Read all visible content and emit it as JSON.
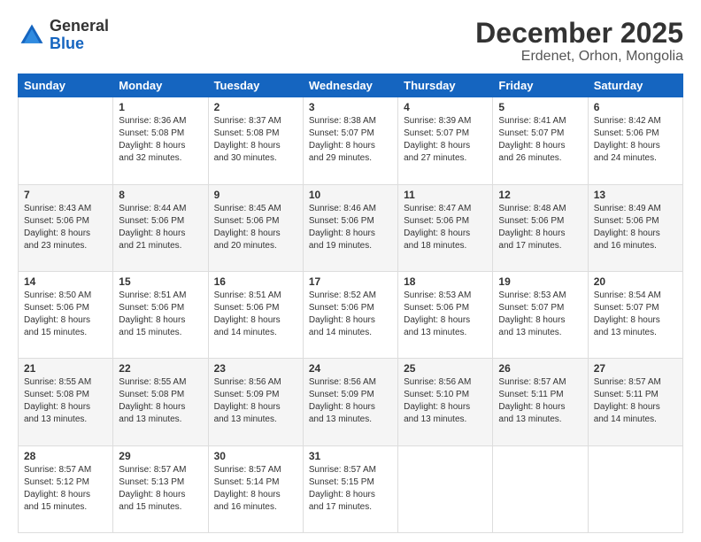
{
  "header": {
    "logo_line1": "General",
    "logo_line2": "Blue",
    "month": "December 2025",
    "location": "Erdenet, Orhon, Mongolia"
  },
  "weekdays": [
    "Sunday",
    "Monday",
    "Tuesday",
    "Wednesday",
    "Thursday",
    "Friday",
    "Saturday"
  ],
  "weeks": [
    [
      {
        "day": "",
        "info": ""
      },
      {
        "day": "1",
        "info": "Sunrise: 8:36 AM\nSunset: 5:08 PM\nDaylight: 8 hours\nand 32 minutes."
      },
      {
        "day": "2",
        "info": "Sunrise: 8:37 AM\nSunset: 5:08 PM\nDaylight: 8 hours\nand 30 minutes."
      },
      {
        "day": "3",
        "info": "Sunrise: 8:38 AM\nSunset: 5:07 PM\nDaylight: 8 hours\nand 29 minutes."
      },
      {
        "day": "4",
        "info": "Sunrise: 8:39 AM\nSunset: 5:07 PM\nDaylight: 8 hours\nand 27 minutes."
      },
      {
        "day": "5",
        "info": "Sunrise: 8:41 AM\nSunset: 5:07 PM\nDaylight: 8 hours\nand 26 minutes."
      },
      {
        "day": "6",
        "info": "Sunrise: 8:42 AM\nSunset: 5:06 PM\nDaylight: 8 hours\nand 24 minutes."
      }
    ],
    [
      {
        "day": "7",
        "info": "Sunrise: 8:43 AM\nSunset: 5:06 PM\nDaylight: 8 hours\nand 23 minutes."
      },
      {
        "day": "8",
        "info": "Sunrise: 8:44 AM\nSunset: 5:06 PM\nDaylight: 8 hours\nand 21 minutes."
      },
      {
        "day": "9",
        "info": "Sunrise: 8:45 AM\nSunset: 5:06 PM\nDaylight: 8 hours\nand 20 minutes."
      },
      {
        "day": "10",
        "info": "Sunrise: 8:46 AM\nSunset: 5:06 PM\nDaylight: 8 hours\nand 19 minutes."
      },
      {
        "day": "11",
        "info": "Sunrise: 8:47 AM\nSunset: 5:06 PM\nDaylight: 8 hours\nand 18 minutes."
      },
      {
        "day": "12",
        "info": "Sunrise: 8:48 AM\nSunset: 5:06 PM\nDaylight: 8 hours\nand 17 minutes."
      },
      {
        "day": "13",
        "info": "Sunrise: 8:49 AM\nSunset: 5:06 PM\nDaylight: 8 hours\nand 16 minutes."
      }
    ],
    [
      {
        "day": "14",
        "info": "Sunrise: 8:50 AM\nSunset: 5:06 PM\nDaylight: 8 hours\nand 15 minutes."
      },
      {
        "day": "15",
        "info": "Sunrise: 8:51 AM\nSunset: 5:06 PM\nDaylight: 8 hours\nand 15 minutes."
      },
      {
        "day": "16",
        "info": "Sunrise: 8:51 AM\nSunset: 5:06 PM\nDaylight: 8 hours\nand 14 minutes."
      },
      {
        "day": "17",
        "info": "Sunrise: 8:52 AM\nSunset: 5:06 PM\nDaylight: 8 hours\nand 14 minutes."
      },
      {
        "day": "18",
        "info": "Sunrise: 8:53 AM\nSunset: 5:06 PM\nDaylight: 8 hours\nand 13 minutes."
      },
      {
        "day": "19",
        "info": "Sunrise: 8:53 AM\nSunset: 5:07 PM\nDaylight: 8 hours\nand 13 minutes."
      },
      {
        "day": "20",
        "info": "Sunrise: 8:54 AM\nSunset: 5:07 PM\nDaylight: 8 hours\nand 13 minutes."
      }
    ],
    [
      {
        "day": "21",
        "info": "Sunrise: 8:55 AM\nSunset: 5:08 PM\nDaylight: 8 hours\nand 13 minutes."
      },
      {
        "day": "22",
        "info": "Sunrise: 8:55 AM\nSunset: 5:08 PM\nDaylight: 8 hours\nand 13 minutes."
      },
      {
        "day": "23",
        "info": "Sunrise: 8:56 AM\nSunset: 5:09 PM\nDaylight: 8 hours\nand 13 minutes."
      },
      {
        "day": "24",
        "info": "Sunrise: 8:56 AM\nSunset: 5:09 PM\nDaylight: 8 hours\nand 13 minutes."
      },
      {
        "day": "25",
        "info": "Sunrise: 8:56 AM\nSunset: 5:10 PM\nDaylight: 8 hours\nand 13 minutes."
      },
      {
        "day": "26",
        "info": "Sunrise: 8:57 AM\nSunset: 5:11 PM\nDaylight: 8 hours\nand 13 minutes."
      },
      {
        "day": "27",
        "info": "Sunrise: 8:57 AM\nSunset: 5:11 PM\nDaylight: 8 hours\nand 14 minutes."
      }
    ],
    [
      {
        "day": "28",
        "info": "Sunrise: 8:57 AM\nSunset: 5:12 PM\nDaylight: 8 hours\nand 15 minutes."
      },
      {
        "day": "29",
        "info": "Sunrise: 8:57 AM\nSunset: 5:13 PM\nDaylight: 8 hours\nand 15 minutes."
      },
      {
        "day": "30",
        "info": "Sunrise: 8:57 AM\nSunset: 5:14 PM\nDaylight: 8 hours\nand 16 minutes."
      },
      {
        "day": "31",
        "info": "Sunrise: 8:57 AM\nSunset: 5:15 PM\nDaylight: 8 hours\nand 17 minutes."
      },
      {
        "day": "",
        "info": ""
      },
      {
        "day": "",
        "info": ""
      },
      {
        "day": "",
        "info": ""
      }
    ]
  ]
}
